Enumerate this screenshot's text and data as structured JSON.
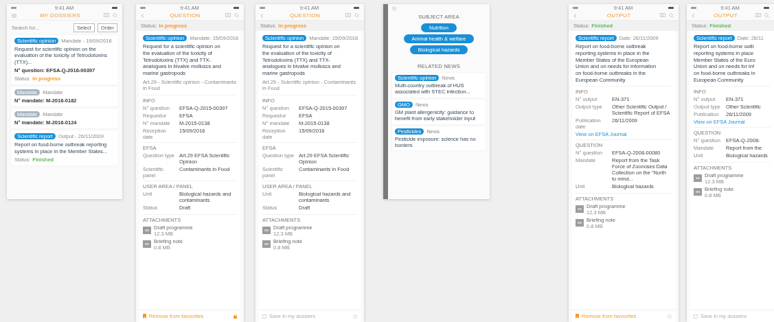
{
  "screens": [
    {
      "kind": "list",
      "time": "9:41 AM",
      "title": "MY DOSSIERS",
      "search_placeholder": "Search for...",
      "buttons": [
        "Select",
        "Order"
      ],
      "cards": [
        {
          "tag": {
            "text": "Scientific opinion",
            "color": "#1a8fd6"
          },
          "meta": "Mandate - 19/09/2016",
          "text": "Request for scientific opinion on the evaluation of the toxicity of Tetrodotoxins (TTX)...",
          "number": "N° question: EFSA-Q-2016-00397",
          "status": {
            "label": "Status:",
            "value": "In progress",
            "color": "#f39a2b"
          }
        },
        {
          "tag": {
            "text": "Mandate",
            "color": "#a9b4bd"
          },
          "meta": "Mandate",
          "number": "N° mandate: M-2016-0182"
        },
        {
          "tag": {
            "text": "Mandate",
            "color": "#a9b4bd"
          },
          "meta": "Mandate",
          "number": "N° mandate: M-2016-0124"
        },
        {
          "tag": {
            "text": "Scientific report",
            "color": "#1a8fd6"
          },
          "meta": "Output - 26/11/2009",
          "text": "Report on food-borne outbreak reporting systems in place in the Member States...",
          "status": {
            "label": "Status:",
            "value": "Finished",
            "color": "#5cb85c"
          }
        }
      ]
    },
    {
      "kind": "detail",
      "time": "9:41 AM",
      "title": "QUESTION",
      "status": {
        "label": "Status:",
        "value": "In progress",
        "color": "#f39a2b"
      },
      "tag": {
        "text": "Scientific opinion",
        "color": "#1a8fd6"
      },
      "meta": "Mandate: 15/09/2016",
      "heading": [
        "Request for a scientific opinion on",
        "the evaluation of the toxicity of",
        "Tetrodotoxins (TTX) and TTX-",
        "analogues in bivalve molluscs and",
        "marine gastropods"
      ],
      "subtitle": "Art.29 - Scientific opinion - Contaminants in Food",
      "sections": [
        {
          "title": "INFO",
          "rows": [
            {
              "label": "N° question",
              "value": "EFSA-Q-2015-00397"
            },
            {
              "label": "Requestor",
              "value": "EFSA"
            },
            {
              "label": "N° mandate",
              "value": "M-2015-0138"
            },
            {
              "label": "Reception date",
              "value": "15/09/2016"
            }
          ]
        },
        {
          "title": "EFSA",
          "rows": [
            {
              "label": "Question type",
              "value": "Art.29 EFSA Scientific Opinion"
            },
            {
              "label": "Scientific panel",
              "value": "Contaminants in Food"
            }
          ]
        },
        {
          "title": "USER AREA / PANEL",
          "rows": [
            {
              "label": "Unit",
              "value": "Biological hazards and contaminants"
            },
            {
              "label": "Status",
              "value": "Draft"
            }
          ]
        }
      ],
      "attachments_title": "ATTACHMENTS",
      "attachments": [
        {
          "name": "Draft programme",
          "size": "12.3 MB"
        },
        {
          "name": "Briefing note",
          "size": "0.8 MB"
        }
      ],
      "footer": {
        "label": "Remove from favourites",
        "saved": true,
        "locked": true
      }
    },
    {
      "kind": "detail",
      "time": "9:41 AM",
      "title": "QUESTION",
      "status": {
        "label": "Status:",
        "value": "In progress",
        "color": "#f39a2b"
      },
      "tag": {
        "text": "Scientific opinion",
        "color": "#1a8fd6"
      },
      "meta": "Mandate: 15/09/2016",
      "heading": [
        "Request for a scientific opinion on",
        "the evaluation of the toxicity of",
        "Tetrodotoxins (TTX) and TTX-",
        "analogues in bivalve molluscs and",
        "marine gastropods"
      ],
      "subtitle": "Art.29 - Scientific opinion - Contaminants in Food",
      "sections": [
        {
          "title": "INFO",
          "rows": [
            {
              "label": "N° question",
              "value": "EFSA-Q-2015-00397"
            },
            {
              "label": "Requestor",
              "value": "EFSA"
            },
            {
              "label": "N° mandate",
              "value": "M-2015-0138"
            },
            {
              "label": "Reception date",
              "value": "15/09/2016"
            }
          ]
        },
        {
          "title": "EFSA",
          "rows": [
            {
              "label": "Question type",
              "value": "Art.29 EFSA Scientific Opinion"
            },
            {
              "label": "Scientific panel",
              "value": "Contaminants in Food"
            }
          ]
        },
        {
          "title": "USER AREA / PANEL",
          "rows": [
            {
              "label": "Unit",
              "value": "Biological hazards and contaminants"
            },
            {
              "label": "Status",
              "value": "Draft"
            }
          ]
        }
      ],
      "attachments_title": "ATTACHMENTS",
      "attachments": [
        {
          "name": "Draft programme",
          "size": "12.3 MB"
        },
        {
          "name": "Briefing note",
          "size": "0.8 MB"
        }
      ],
      "footer": {
        "label": "Save in my dossiers",
        "saved": false,
        "locked": false
      }
    },
    {
      "kind": "subject",
      "title": "SUBJECT AREA",
      "buttons": [
        "Nutrition",
        "Animal health & welfare",
        "Biological hazards"
      ],
      "news_title": "RELATED NEWS",
      "news": [
        {
          "tag": {
            "text": "Scientific opinion",
            "color": "#1a8fd6"
          },
          "meta": "News",
          "text": "Multi-country outbreak of HUS associated with STEC infection..."
        },
        {
          "tag": {
            "text": "GMO",
            "color": "#1a8fd6"
          },
          "meta": "News",
          "text": "GM plant allergenicity: guidance to benefit from early stakeholder input"
        },
        {
          "tag": {
            "text": "Pesticides",
            "color": "#1a8fd6"
          },
          "meta": "News",
          "text": "Pesticide exposure: science has no borders"
        }
      ]
    },
    {
      "kind": "detail",
      "time": "9:41 AM",
      "title": "OUTPUT",
      "status": {
        "label": "Status:",
        "value": "Finished",
        "color": "#5cb85c"
      },
      "tag": {
        "text": "Scientific report",
        "color": "#1a8fd6"
      },
      "meta": "Date: 26/11/2009",
      "heading": [
        "Report on food-borne outbreak",
        "reporting systems in place in the",
        "Member States of the European",
        "Union and on needs for information",
        "on food-borne outbreaks in the",
        "European Community"
      ],
      "sections": [
        {
          "title": "INFO",
          "rows": [
            {
              "label": "N° output",
              "value": "EN-371"
            },
            {
              "label": "Output type",
              "value": "Other Scientific Output / Scientific Report of EFSA"
            },
            {
              "label": "Publication date",
              "value": "26/11/2009"
            }
          ],
          "link": "View on EFSA Journal"
        },
        {
          "title": "QUESTION",
          "rows": [
            {
              "label": "N° question",
              "value": "EFSA-Q-2008-00080"
            },
            {
              "label": "Mandate",
              "value": "Report from the Task Force of Zoonoses Data Collection on the \"North to mind..."
            },
            {
              "label": "Unit",
              "value": "Biological hazards"
            }
          ]
        }
      ],
      "attachments_title": "ATTACHMENTS",
      "attachments": [
        {
          "name": "Draft programme",
          "size": "12.3 MB"
        },
        {
          "name": "Briefing note",
          "size": "0.8 MB"
        }
      ],
      "footer": {
        "label": "Remove from favourites",
        "saved": true,
        "locked": false
      }
    },
    {
      "kind": "detail",
      "time": "9:41 AM",
      "title": "OUTPUT",
      "status": {
        "label": "Status:",
        "value": "Finished",
        "color": "#5cb85c"
      },
      "tag": {
        "text": "Scientific report",
        "color": "#1a8fd6"
      },
      "meta": "Date: 26/11",
      "heading": [
        "Report on food-borne outb",
        "reporting systems in place",
        "Member States of the Euro",
        "Union and on needs for inf",
        "on food-borne outbreaks in",
        "European Community"
      ],
      "sections": [
        {
          "title": "INFO",
          "rows": [
            {
              "label": "N° output",
              "value": "EN-371"
            },
            {
              "label": "Output type",
              "value": "Other Scientific"
            },
            {
              "label": "Publication",
              "value": "26/11/2009"
            }
          ],
          "link": "View on EFSA Journal"
        },
        {
          "title": "QUESTION",
          "rows": [
            {
              "label": "N° question",
              "value": "EFSA-Q-2008-"
            },
            {
              "label": "Mandate",
              "value": "Report from the"
            },
            {
              "label": "Unit",
              "value": "Biological hazards"
            }
          ]
        }
      ],
      "attachments_title": "ATTACHMENTS",
      "attachments": [
        {
          "name": "Draft programme",
          "size": "12.3 MB"
        },
        {
          "name": "Briefing note",
          "size": "0.8 MB"
        }
      ],
      "footer": {
        "label": "Save in my dossiers",
        "saved": false
      }
    }
  ]
}
